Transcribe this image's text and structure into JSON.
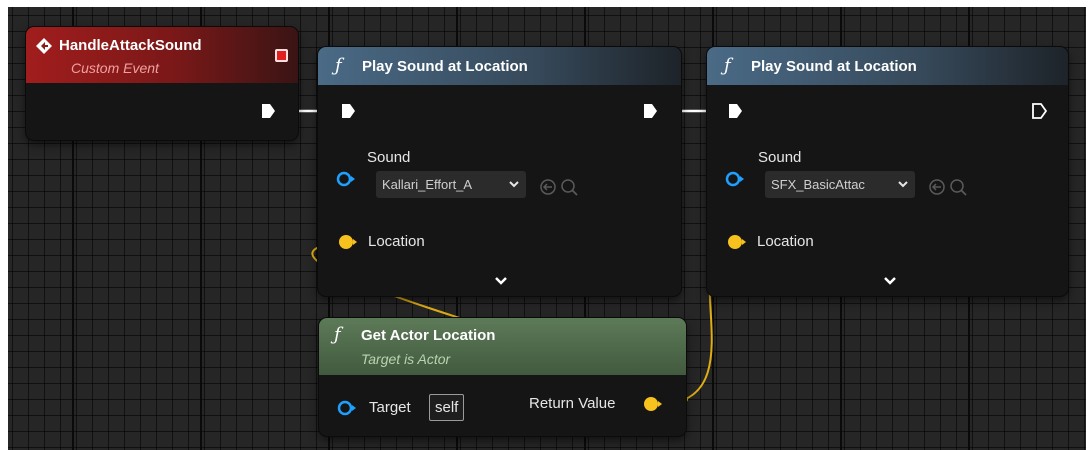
{
  "colors": {
    "event_header": "#8e1b1b",
    "function_header": "#3b5469",
    "pure_header": "#4b6848",
    "exec_wire": "#ffffff",
    "vector_pin": "#f7c21e",
    "object_pin": "#1fa0ff"
  },
  "event_node": {
    "title": "HandleAttackSound",
    "subtitle": "Custom Event",
    "icon": "event-diamond-icon",
    "delegate_icon": "red-square-icon"
  },
  "play_sound_1": {
    "title": "Play Sound at Location",
    "sound_label": "Sound",
    "sound_value": "Kallari_Effort_A",
    "location_label": "Location"
  },
  "play_sound_2": {
    "title": "Play Sound at Location",
    "sound_label": "Sound",
    "sound_value": "SFX_BasicAttac",
    "location_label": "Location"
  },
  "get_actor_location": {
    "title": "Get Actor Location",
    "subtitle": "Target is Actor",
    "target_label": "Target",
    "target_value": "self",
    "return_label": "Return Value"
  },
  "function_glyph": "ƒ"
}
